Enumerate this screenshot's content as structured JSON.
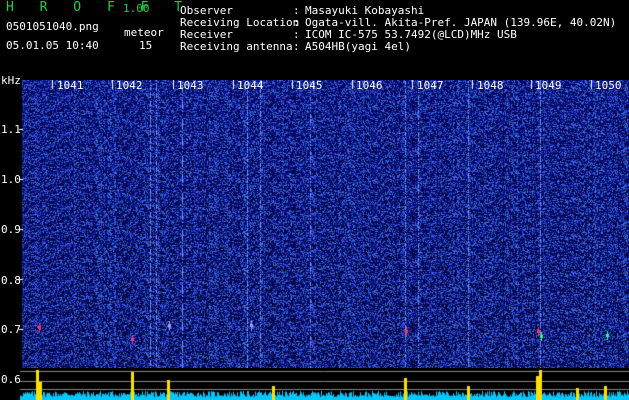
{
  "header": {
    "app_title": "H R O F F T",
    "version": "1.00",
    "filename": "0501051040.png",
    "datetime": "05.01.05 10:40",
    "count_label": "meteor",
    "count_value": "15",
    "info_rows": [
      {
        "key": "Observer",
        "sep": ":",
        "value": "Masayuki Kobayashi"
      },
      {
        "key": "Receiving Location",
        "sep": ":",
        "value": "Ogata-vill. Akita-Pref. JAPAN (139.96E, 40.02N)"
      },
      {
        "key": "Receiver",
        "sep": ":",
        "value": "ICOM IC-575 53.7492(@LCD)MHz USB"
      },
      {
        "key": "Receiving antenna",
        "sep": ":",
        "value": "A504HB(yagi 4el)"
      }
    ]
  },
  "spectrogram": {
    "y_unit": "kHz",
    "y_ticks": [
      "1.1",
      "1.0",
      "0.9",
      "0.8",
      "0.7",
      "0.6"
    ],
    "minute_labels": [
      "1041",
      "1042",
      "1043",
      "1044",
      "1045",
      "1046",
      "1047",
      "1048",
      "1049",
      "1050"
    ]
  },
  "chart_data": {
    "type": "heatmap",
    "ylabel": "kHz",
    "y_ticks": [
      1.1,
      1.0,
      0.9,
      0.8,
      0.7,
      0.6
    ],
    "x_ticks": [
      "1041",
      "1042",
      "1043",
      "1044",
      "1045",
      "1046",
      "1047",
      "1048",
      "1049",
      "1050"
    ],
    "meteor_count": 15,
    "colors": {
      "background": "#0a0a8c",
      "noise": "#3c5cff",
      "echo": "#ff3060",
      "spectrum": "#00c8ff",
      "peak": "#ffe000"
    }
  }
}
